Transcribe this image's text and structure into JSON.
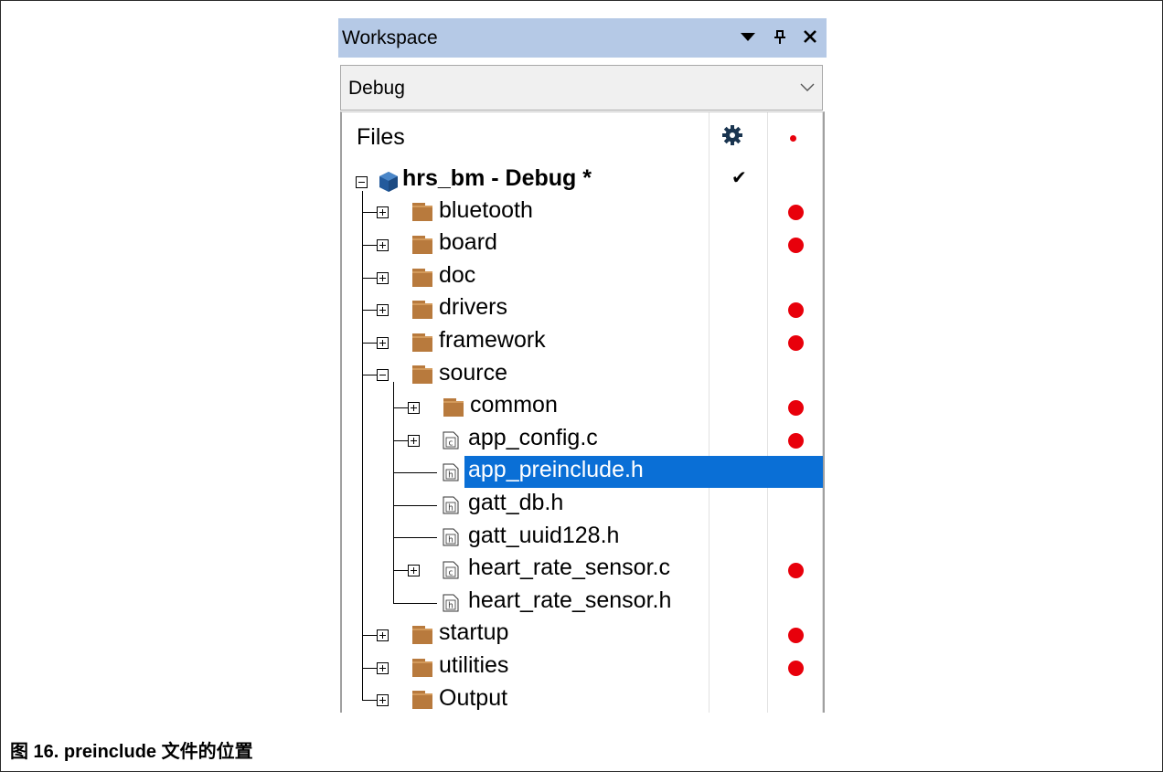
{
  "workspace": {
    "title": "Workspace",
    "config": "Debug",
    "files_header": "Files"
  },
  "tree": {
    "root": "hrs_bm - Debug *",
    "items": [
      {
        "label": "bluetooth",
        "kind": "folder",
        "level": 1,
        "state": "collapsed",
        "dot": true
      },
      {
        "label": "board",
        "kind": "folder",
        "level": 1,
        "state": "collapsed",
        "dot": true
      },
      {
        "label": "doc",
        "kind": "folder",
        "level": 1,
        "state": "collapsed",
        "dot": false
      },
      {
        "label": "drivers",
        "kind": "folder",
        "level": 1,
        "state": "collapsed",
        "dot": true
      },
      {
        "label": "framework",
        "kind": "folder",
        "level": 1,
        "state": "collapsed",
        "dot": true
      },
      {
        "label": "source",
        "kind": "folder",
        "level": 1,
        "state": "expanded",
        "dot": false
      },
      {
        "label": "common",
        "kind": "folder",
        "level": 2,
        "state": "collapsed",
        "dot": true
      },
      {
        "label": "app_config.c",
        "kind": "c-file",
        "level": 2,
        "state": "collapsed",
        "dot": true
      },
      {
        "label": "app_preinclude.h",
        "kind": "h-file",
        "level": 2,
        "state": "leaf",
        "dot": false,
        "selected": true
      },
      {
        "label": "gatt_db.h",
        "kind": "h-file",
        "level": 2,
        "state": "leaf",
        "dot": false
      },
      {
        "label": "gatt_uuid128.h",
        "kind": "h-file",
        "level": 2,
        "state": "leaf",
        "dot": false
      },
      {
        "label": "heart_rate_sensor.c",
        "kind": "c-file",
        "level": 2,
        "state": "collapsed",
        "dot": true
      },
      {
        "label": "heart_rate_sensor.h",
        "kind": "h-file",
        "level": 2,
        "state": "leaf",
        "dot": false
      },
      {
        "label": "startup",
        "kind": "folder",
        "level": 1,
        "state": "collapsed",
        "dot": true
      },
      {
        "label": "utilities",
        "kind": "folder",
        "level": 1,
        "state": "collapsed",
        "dot": true
      },
      {
        "label": "Output",
        "kind": "folder",
        "level": 1,
        "state": "collapsed",
        "dot": false
      }
    ]
  },
  "icons": {
    "dropdown": "dropdown-arrow-icon",
    "pin": "pin-icon",
    "close": "close-icon",
    "gear": "gear-icon",
    "check": "checkmark-icon",
    "dot": "red-dot-icon"
  },
  "colors": {
    "header_bg": "#b5c9e6",
    "selection": "#0a6fd6",
    "folder": "#b87a3d",
    "dot": "#e8000b"
  },
  "caption": "图 16. preinclude 文件的位置"
}
